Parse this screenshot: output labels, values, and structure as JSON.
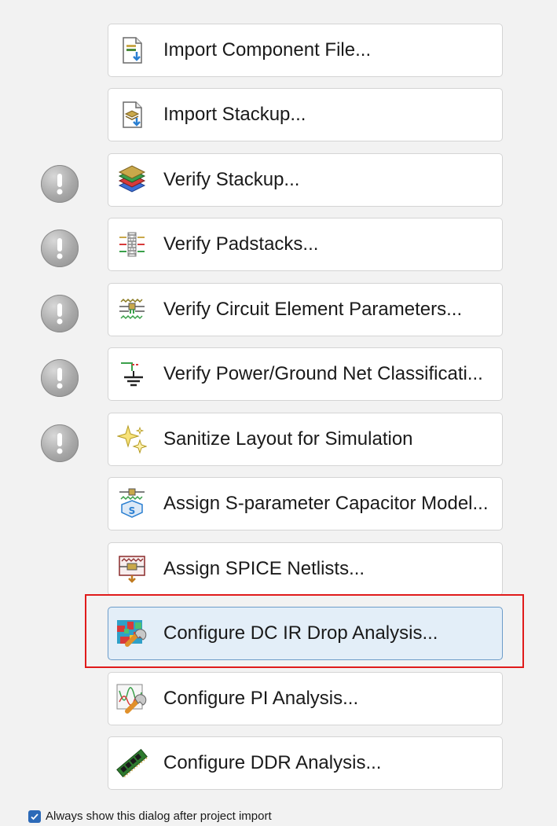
{
  "steps": [
    {
      "label": "Import Component File...",
      "icon": "import-component-file-icon",
      "status": null
    },
    {
      "label": "Import Stackup...",
      "icon": "import-stackup-icon",
      "status": null
    },
    {
      "label": "Verify Stackup...",
      "icon": "layers-stackup-icon",
      "status": "warning"
    },
    {
      "label": "Verify Padstacks...",
      "icon": "padstacks-icon",
      "status": "warning"
    },
    {
      "label": "Verify Circuit Element Parameters...",
      "icon": "circuit-element-icon",
      "status": "warning"
    },
    {
      "label": "Verify Power/Ground Net Classificati...",
      "icon": "power-ground-icon",
      "status": "warning"
    },
    {
      "label": "Sanitize Layout for Simulation",
      "icon": "sparkle-sanitize-icon",
      "status": "warning"
    },
    {
      "label": "Assign S-parameter Capacitor Model...",
      "icon": "s-parameter-icon",
      "status": null
    },
    {
      "label": "Assign SPICE Netlists...",
      "icon": "spice-netlist-icon",
      "status": null
    },
    {
      "label": "Configure DC IR Drop Analysis...",
      "icon": "dc-ir-drop-icon",
      "status": null,
      "selected": true
    },
    {
      "label": "Configure PI Analysis...",
      "icon": "pi-analysis-icon",
      "status": null
    },
    {
      "label": "Configure DDR Analysis...",
      "icon": "ddr-memory-icon",
      "status": null
    }
  ],
  "footer": {
    "checkbox_checked": true,
    "checkbox_label": "Always show this dialog after project import"
  },
  "colors": {
    "highlight": "#e01b1b",
    "selected_bg": "#e3eef8",
    "checkbox": "#2c6ab8"
  }
}
